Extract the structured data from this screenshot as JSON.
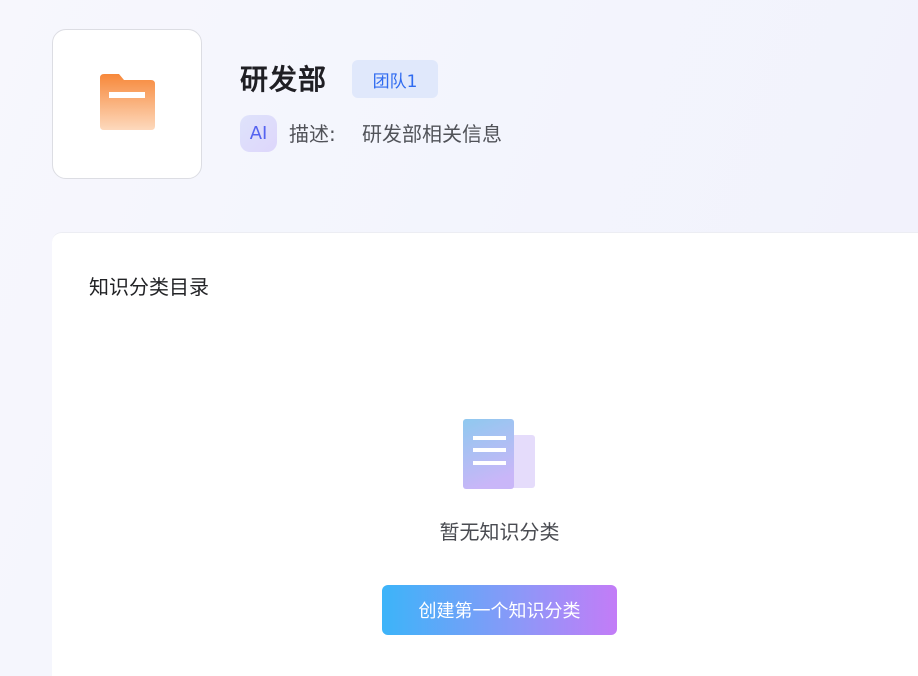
{
  "header": {
    "title": "研发部",
    "team_badge": "团队1",
    "ai_badge": "AI",
    "description_label": "描述:",
    "description_value": "研发部相关信息",
    "folder_icon": "folder-icon"
  },
  "catalog": {
    "section_title": "知识分类目录",
    "empty_icon": "document-stack-icon",
    "empty_text": "暂无知识分类",
    "create_button_label": "创建第一个知识分类"
  },
  "colors": {
    "accent_blue": "#2f6bf0",
    "badge_bg": "#e0e8fb",
    "button_gradient_start": "#3cb4f9",
    "button_gradient_end": "#c37cf7",
    "folder_orange": "#f8913f"
  }
}
